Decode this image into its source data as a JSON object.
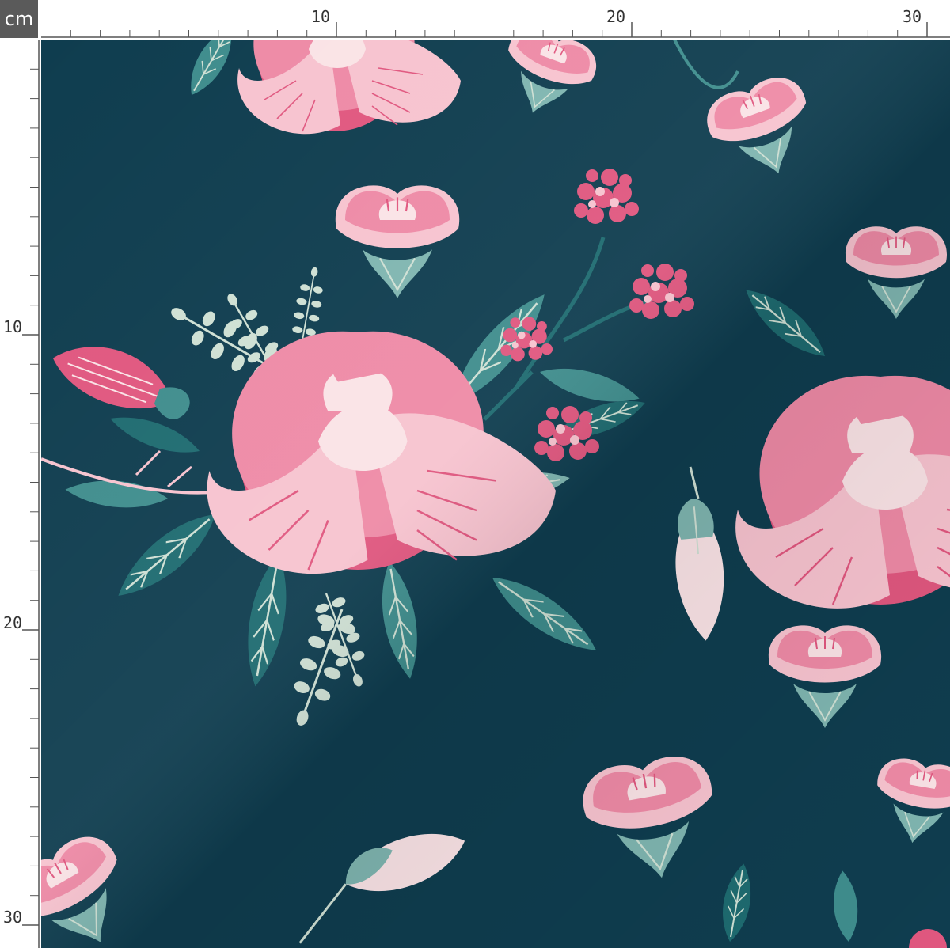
{
  "ruler": {
    "unit": "cm",
    "top_labels": [
      "10",
      "20",
      "30"
    ],
    "left_labels": [
      "10",
      "20",
      "30"
    ]
  },
  "fabric": {
    "pattern": "floral",
    "background_color": "#0f3d4f",
    "palette": {
      "deep_pink": "#e0577f",
      "mid_pink": "#ee8aa6",
      "light_pink": "#f7c3cf",
      "blush": "#fae3e6",
      "teal_dark": "#1e6b70",
      "teal": "#3f8d8d",
      "teal_light": "#7fb5b0",
      "sage": "#cfe0d4"
    }
  }
}
